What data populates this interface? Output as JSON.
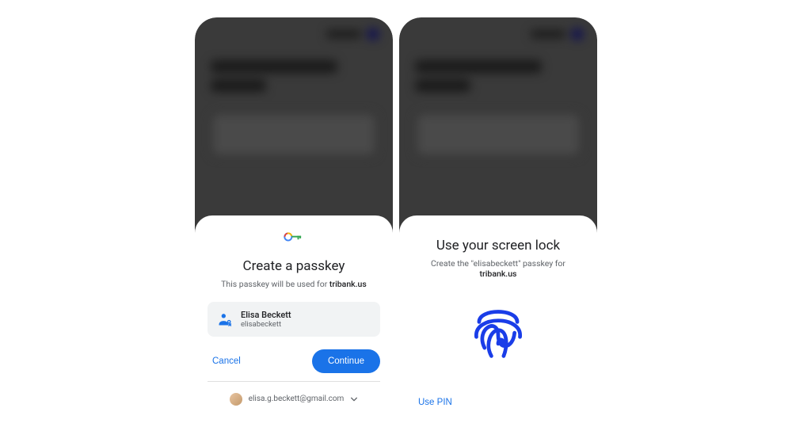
{
  "screen1": {
    "title": "Create a passkey",
    "subtitle_prefix": "This passkey will be used for ",
    "subtitle_site": "tribank.us",
    "account": {
      "name": "Elisa Beckett",
      "username": "elisabeckett"
    },
    "cancel_label": "Cancel",
    "continue_label": "Continue",
    "switcher_email": "elisa.g.beckett@gmail.com"
  },
  "screen2": {
    "title": "Use your screen lock",
    "subtitle_prefix": "Create the \"elisabeckett\" passkey for ",
    "subtitle_site": "tribank.us",
    "use_pin_label": "Use PIN"
  }
}
